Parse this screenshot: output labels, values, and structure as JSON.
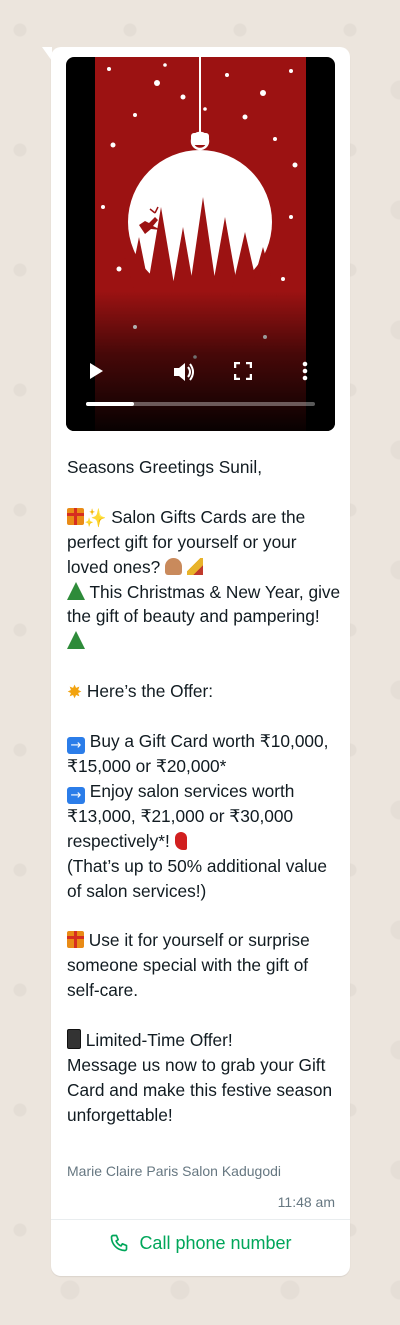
{
  "message": {
    "greeting": "Seasons Greetings Sunil,",
    "line1": " Salon Gifts Cards are the perfect gift for yourself or your loved ones? ",
    "line2": " This Christmas & New Year, give the gift of beauty and pampering! ",
    "line3": " Here’s the Offer:",
    "line4": " Buy a Gift Card worth ₹10,000, ₹15,000 or ₹20,000*",
    "line5": " Enjoy salon services worth ₹13,000, ₹21,000 or ₹30,000 respectively*! ",
    "line6": "(That’s up to 50% additional value of salon services!)",
    "line7": " Use it for yourself or surprise someone special with the gift of self-care.",
    "line8": " Limited-Time Offer!",
    "line9": "Message us now to grab your Gift Card and make this festive season unforgettable!",
    "sender": "Marie Claire Paris Salon Kadugodi",
    "time": "11:48 am"
  },
  "video": {
    "progress": 0.21
  },
  "action": {
    "call_label": "Call phone number",
    "accent": "#00a65a"
  },
  "icons": [
    "play-icon",
    "volume-icon",
    "fullscreen-icon",
    "more-options-icon",
    "phone-icon"
  ]
}
